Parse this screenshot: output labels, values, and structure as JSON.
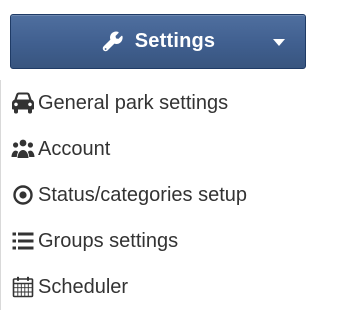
{
  "button": {
    "label": "Settings",
    "icon": "wrench-icon",
    "caret_icon": "caret-down-icon",
    "background_color": "#405f8f"
  },
  "menu": {
    "items": [
      {
        "label": "General park settings",
        "icon": "car-icon"
      },
      {
        "label": "Account",
        "icon": "users-icon"
      },
      {
        "label": "Status/categories setup",
        "icon": "dot-circle-icon"
      },
      {
        "label": "Groups settings",
        "icon": "list-icon"
      },
      {
        "label": "Scheduler",
        "icon": "calendar-icon"
      }
    ]
  }
}
